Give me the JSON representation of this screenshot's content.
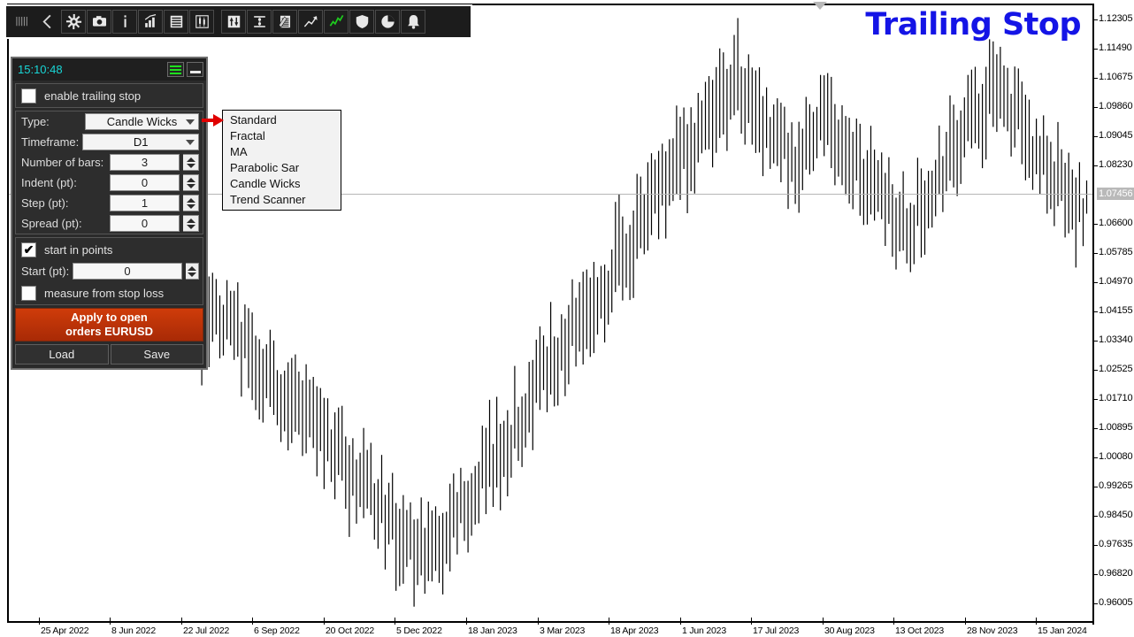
{
  "window": {
    "title_overlay": "Trailing Stop"
  },
  "toolbar": {
    "items": [
      {
        "name": "drag-grip-icon",
        "glyph": "grip",
        "interactable": true
      },
      {
        "name": "collapse-left-icon",
        "glyph": "chevron-left",
        "interactable": true
      },
      {
        "name": "settings-gear-icon",
        "glyph": "gear",
        "interactable": true
      },
      {
        "name": "screenshot-camera-icon",
        "glyph": "camera",
        "interactable": true
      },
      {
        "name": "info-icon",
        "glyph": "info",
        "interactable": true
      },
      {
        "name": "bar-chart-icon",
        "glyph": "barchart",
        "interactable": true
      },
      {
        "name": "list-icon",
        "glyph": "list",
        "interactable": true
      },
      {
        "name": "candlestick-icon",
        "glyph": "candles",
        "interactable": true
      },
      {
        "name": "buy-sell-arrows-icon",
        "glyph": "updown",
        "interactable": true
      },
      {
        "name": "spread-ibeam-icon",
        "glyph": "ibeam",
        "interactable": true
      },
      {
        "name": "notes-document-icon",
        "glyph": "document",
        "interactable": true
      },
      {
        "name": "trend-arrow-icon",
        "glyph": "trendarrow",
        "interactable": true
      },
      {
        "name": "zigzag-indicator-icon",
        "glyph": "zigzag",
        "interactable": true
      },
      {
        "name": "shield-icon",
        "glyph": "shield",
        "interactable": true
      },
      {
        "name": "pie-chart-icon",
        "glyph": "pie",
        "interactable": true
      },
      {
        "name": "alert-bell-icon",
        "glyph": "bell",
        "interactable": true
      }
    ]
  },
  "panel": {
    "clock": "15:10:48",
    "menu_button": "hamburger-icon",
    "minimize_button": "minimize-icon",
    "enable_trailing_stop": {
      "label": "enable trailing stop",
      "checked": false
    },
    "fields": [
      {
        "label": "Type:",
        "value": "Candle Wicks",
        "kind": "select",
        "name": "type-select"
      },
      {
        "label": "Timeframe:",
        "value": "D1",
        "kind": "select",
        "name": "timeframe-select"
      },
      {
        "label": "Number of bars:",
        "value": "3",
        "kind": "number",
        "name": "number-of-bars-input"
      },
      {
        "label": "Indent (pt):",
        "value": "0",
        "kind": "number",
        "name": "indent-input"
      },
      {
        "label": "Step (pt):",
        "value": "1",
        "kind": "number",
        "name": "step-input"
      },
      {
        "label": "Spread (pt):",
        "value": "0",
        "kind": "number",
        "name": "spread-input"
      }
    ],
    "start_in_points": {
      "label": "start in points",
      "checked": true
    },
    "start_field": {
      "label": "Start (pt):",
      "value": "0"
    },
    "measure_from_stop_loss": {
      "label": "measure from stop loss",
      "checked": false
    },
    "apply_button_line1": "Apply to open",
    "apply_button_line2": "orders EURUSD",
    "load_button": "Load",
    "save_button": "Save"
  },
  "dropdown": {
    "open": true,
    "pointer": "red-arrow-icon",
    "options": [
      "Standard",
      "Fractal",
      "MA",
      "Parabolic Sar",
      "Candle Wicks",
      "Trend Scanner"
    ]
  },
  "chart_data": {
    "type": "bar",
    "title": "Trailing Stop",
    "symbol": "EURUSD",
    "timeframe": "D1",
    "xlabel": "",
    "ylabel": "",
    "grid": false,
    "legend": "none",
    "current_price": "1.07456",
    "ylim": [
      0.95598,
      1.12712
    ],
    "price_ticks": [
      "1.12305",
      "1.11490",
      "1.10675",
      "1.09860",
      "1.09045",
      "1.08230",
      "1.06600",
      "1.05785",
      "1.04970",
      "1.04155",
      "1.03340",
      "1.02525",
      "1.01710",
      "1.00895",
      "1.00080",
      "0.99265",
      "0.98450",
      "0.97635",
      "0.96820",
      "0.96005"
    ],
    "date_ticks": [
      "25 Apr 2022",
      "8 Jun 2022",
      "22 Jul 2022",
      "6 Sep 2022",
      "20 Oct 2022",
      "5 Dec 2022",
      "18 Jan 2023",
      "3 Mar 2023",
      "18 Apr 2023",
      "1 Jun 2023",
      "17 Jul 2023",
      "30 Aug 2023",
      "13 Oct 2023",
      "28 Nov 2023",
      "15 Jan 2024"
    ],
    "series": [
      {
        "name": "EURUSD D1",
        "note": "OHLC vertical range bars, high/low per bar in price units",
        "bars": [
          [
            1.0905,
            1.0835
          ],
          [
            1.0875,
            1.08
          ],
          [
            1.086,
            1.079
          ],
          [
            1.09,
            1.082
          ],
          [
            1.088,
            1.08
          ],
          [
            1.0845,
            1.076
          ],
          [
            1.08,
            1.0735
          ],
          [
            1.078,
            1.07
          ],
          [
            1.0745,
            1.065
          ],
          [
            1.07,
            1.062
          ],
          [
            1.068,
            1.059
          ],
          [
            1.065,
            1.056
          ],
          [
            1.062,
            1.053
          ],
          [
            1.06,
            1.051
          ],
          [
            1.058,
            1.049
          ],
          [
            1.062,
            1.053
          ],
          [
            1.059,
            1.05
          ],
          [
            1.056,
            1.047
          ],
          [
            1.053,
            1.044
          ],
          [
            1.05,
            1.04
          ],
          [
            1.047,
            1.037
          ],
          [
            1.044,
            1.034
          ],
          [
            1.048,
            1.038
          ],
          [
            1.045,
            1.035
          ],
          [
            1.042,
            1.032
          ],
          [
            1.039,
            1.029
          ],
          [
            1.036,
            1.026
          ],
          [
            1.033,
            1.023
          ],
          [
            1.03,
            1.02
          ],
          [
            1.027,
            1.017
          ],
          [
            1.024,
            1.014
          ],
          [
            1.021,
            1.011
          ],
          [
            1.018,
            1.008
          ],
          [
            1.015,
            1.005
          ],
          [
            1.012,
            1.002
          ],
          [
            1.009,
            0.999
          ],
          [
            1.006,
            0.996
          ],
          [
            1.003,
            0.993
          ],
          [
            1.0,
            0.99
          ],
          [
            0.997,
            0.987
          ],
          [
            0.994,
            0.984
          ],
          [
            0.991,
            0.981
          ],
          [
            0.988,
            0.978
          ],
          [
            0.985,
            0.975
          ],
          [
            0.982,
            0.972
          ],
          [
            0.979,
            0.969
          ],
          [
            0.976,
            0.966
          ],
          [
            0.98,
            0.97
          ],
          [
            0.984,
            0.974
          ],
          [
            0.988,
            0.978
          ],
          [
            0.992,
            0.982
          ],
          [
            0.996,
            0.986
          ],
          [
            1.0,
            0.99
          ],
          [
            1.004,
            0.994
          ],
          [
            1.008,
            0.998
          ],
          [
            1.012,
            1.002
          ],
          [
            1.016,
            1.006
          ],
          [
            1.02,
            1.01
          ],
          [
            1.024,
            1.014
          ],
          [
            1.028,
            1.018
          ],
          [
            1.032,
            1.022
          ],
          [
            1.036,
            1.026
          ],
          [
            1.04,
            1.03
          ],
          [
            1.044,
            1.034
          ],
          [
            1.048,
            1.038
          ],
          [
            1.052,
            1.042
          ],
          [
            1.056,
            1.046
          ],
          [
            1.06,
            1.05
          ],
          [
            1.064,
            1.054
          ],
          [
            1.068,
            1.058
          ],
          [
            1.072,
            1.062
          ],
          [
            1.076,
            1.066
          ],
          [
            1.08,
            1.07
          ],
          [
            1.084,
            1.074
          ],
          [
            1.088,
            1.078
          ],
          [
            1.092,
            1.082
          ],
          [
            1.096,
            1.086
          ],
          [
            1.1,
            1.09
          ],
          [
            1.104,
            1.094
          ],
          [
            1.108,
            1.098
          ],
          [
            1.112,
            1.102
          ],
          [
            1.11,
            1.1
          ],
          [
            1.106,
            1.096
          ],
          [
            1.102,
            1.092
          ],
          [
            1.098,
            1.088
          ],
          [
            1.094,
            1.084
          ],
          [
            1.09,
            1.08
          ],
          [
            1.088,
            1.078
          ],
          [
            1.092,
            1.082
          ],
          [
            1.096,
            1.086
          ],
          [
            1.1,
            1.09
          ],
          [
            1.097,
            1.087
          ],
          [
            1.093,
            1.083
          ],
          [
            1.089,
            1.079
          ],
          [
            1.085,
            1.075
          ],
          [
            1.082,
            1.072
          ],
          [
            1.079,
            1.069
          ],
          [
            1.076,
            1.066
          ],
          [
            1.073,
            1.063
          ],
          [
            1.07,
            1.06
          ],
          [
            1.074,
            1.064
          ],
          [
            1.078,
            1.068
          ],
          [
            1.082,
            1.072
          ],
          [
            1.086,
            1.076
          ],
          [
            1.09,
            1.08
          ],
          [
            1.094,
            1.084
          ],
          [
            1.098,
            1.088
          ],
          [
            1.102,
            1.092
          ],
          [
            1.106,
            1.096
          ],
          [
            1.11,
            1.1
          ],
          [
            1.106,
            1.096
          ],
          [
            1.102,
            1.092
          ],
          [
            1.098,
            1.088
          ],
          [
            1.094,
            1.084
          ],
          [
            1.09,
            1.08
          ],
          [
            1.086,
            1.076
          ],
          [
            1.082,
            1.072
          ],
          [
            1.079,
            1.069
          ],
          [
            1.076,
            1.066
          ],
          [
            1.0745,
            1.07
          ]
        ]
      }
    ]
  }
}
